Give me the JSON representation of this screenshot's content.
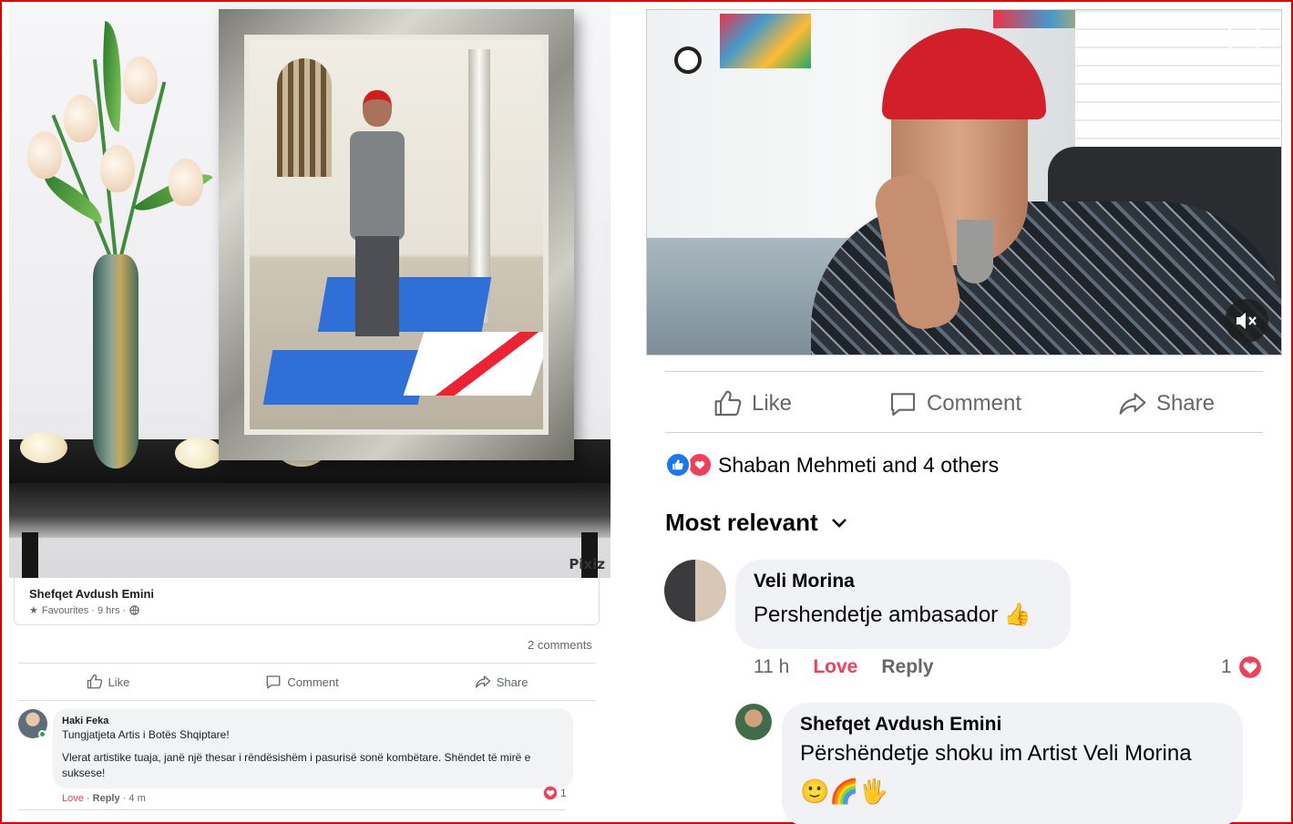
{
  "left": {
    "photo_watermark": "Pixiz",
    "author": "Shefqet Avdush Emini",
    "meta": "Favourites · 9 hrs ·",
    "comments_count": "2 comments",
    "actions": {
      "like": "Like",
      "comment": "Comment",
      "share": "Share"
    },
    "comment": {
      "name": "Haki Feka",
      "line1": "Tungjatjeta Artis i Botës Shqiptare!",
      "line2": "Vlerat artistike tuaja, janë një thesar i rëndësishëm i pasurisë sonë kombëtare. Shëndet të mirë e suksese!",
      "love": "Love",
      "reply": "Reply",
      "time": "4 m",
      "reaction_count": "1"
    }
  },
  "right": {
    "actions": {
      "like": "Like",
      "comment": "Comment",
      "share": "Share"
    },
    "likes_summary": "Shaban Mehmeti and 4 others",
    "sort_label": "Most relevant",
    "comment1": {
      "name": "Veli Morina",
      "text": "Pershendetje ambasador 👍",
      "time": "11 h",
      "love": "Love",
      "reply": "Reply",
      "reaction_count": "1"
    },
    "comment2": {
      "name": "Shefqet Avdush Emini",
      "text": "Përshëndetje shoku im Artist Veli Morina",
      "emoji": "🙂🌈🖐"
    }
  },
  "colors": {
    "accent": "#1877f2",
    "love": "#f33e58",
    "border": "#e00000"
  }
}
